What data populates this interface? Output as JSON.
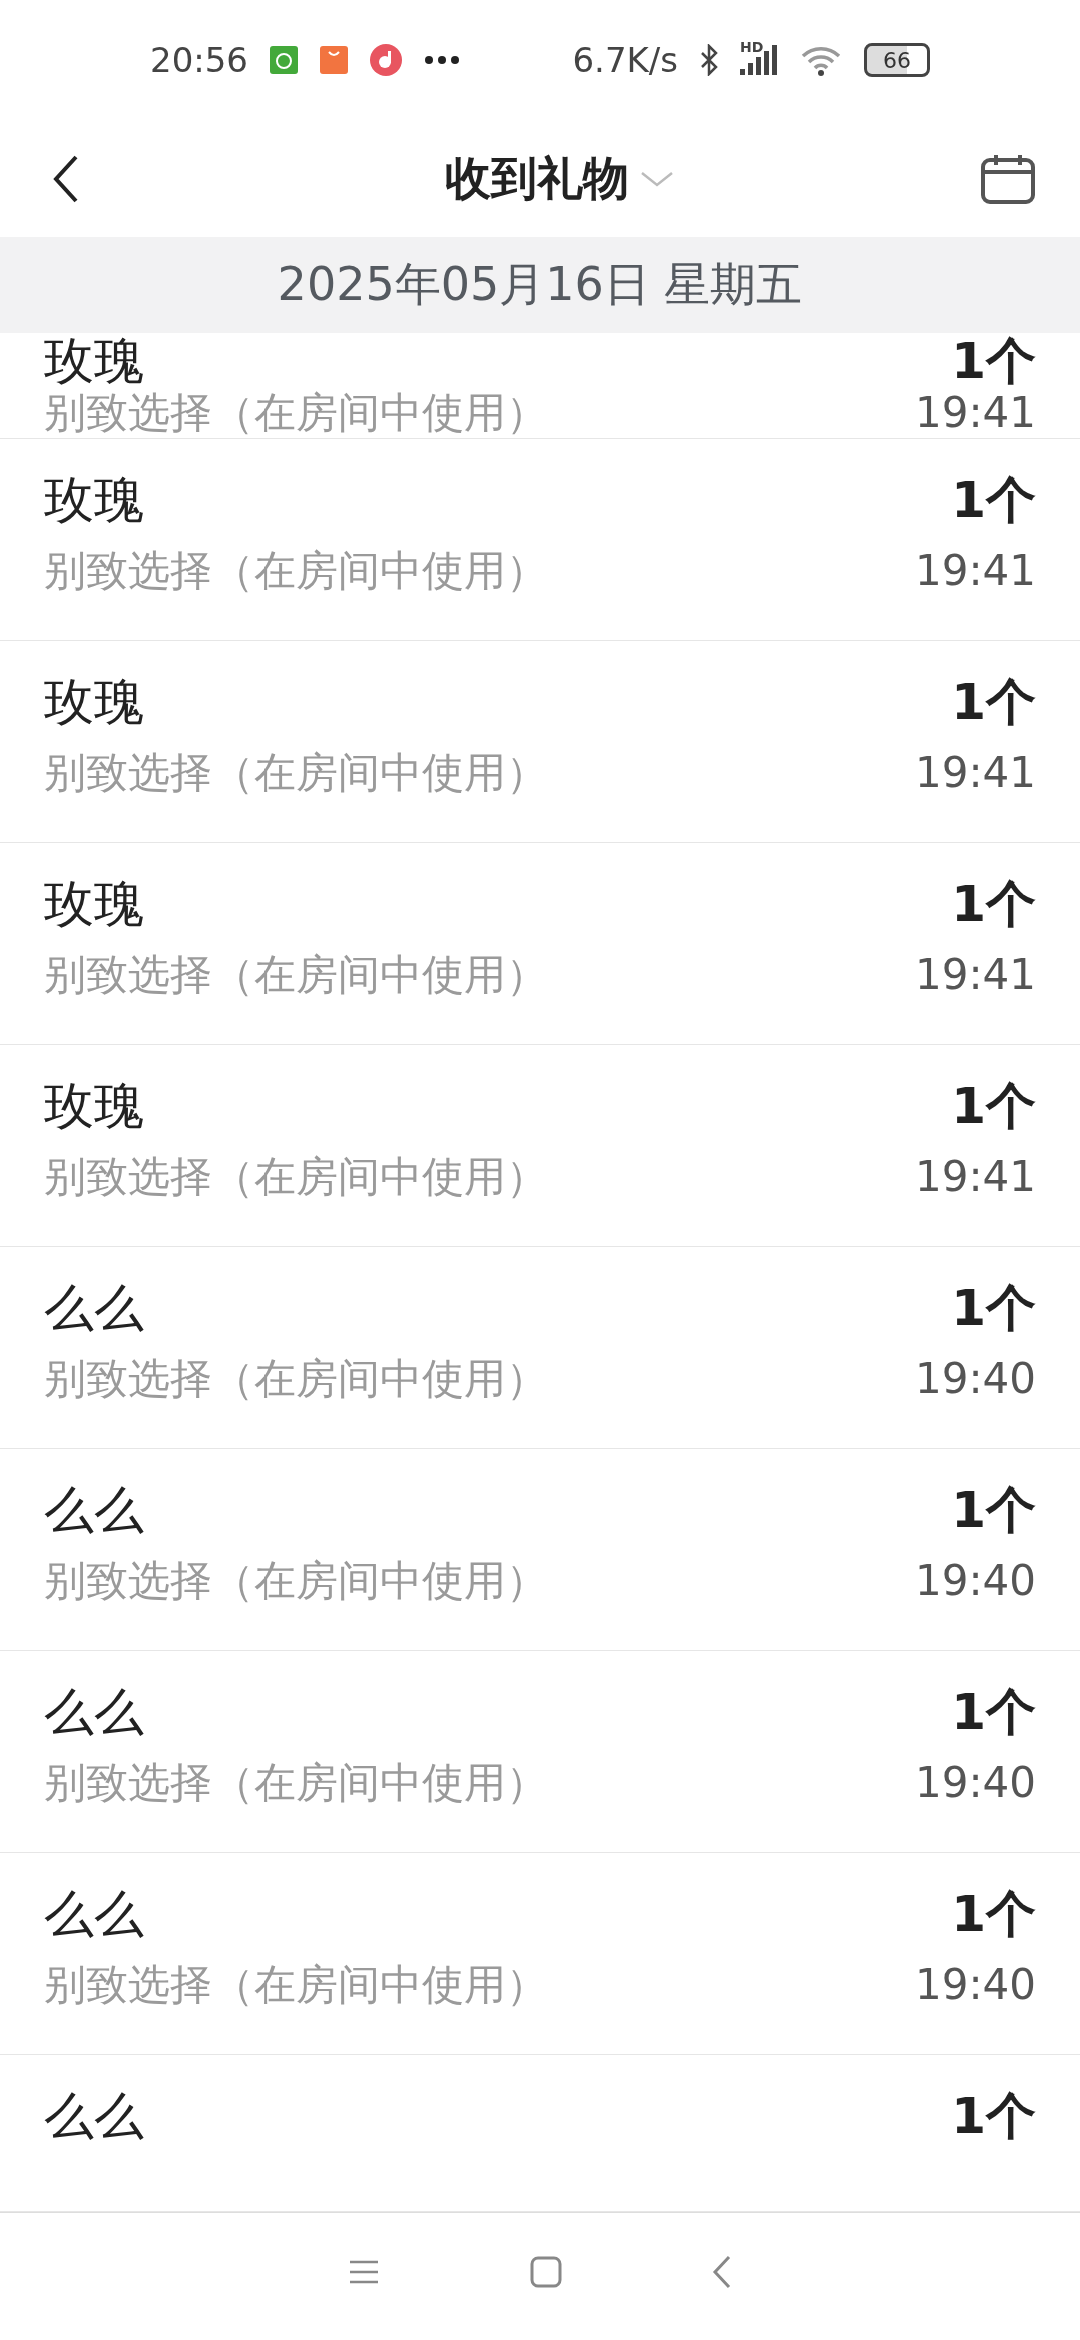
{
  "status_bar": {
    "time": "20:56",
    "net_speed": "6.7K/s",
    "signal_label": "HD",
    "battery": "66"
  },
  "header": {
    "title": "收到礼物"
  },
  "date_header": "2025年05月16日 星期五",
  "gifts": [
    {
      "name": "玫瑰",
      "source": "别致选择（在房间中使用）",
      "count": "1个",
      "time": "19:41"
    },
    {
      "name": "玫瑰",
      "source": "别致选择（在房间中使用）",
      "count": "1个",
      "time": "19:41"
    },
    {
      "name": "玫瑰",
      "source": "别致选择（在房间中使用）",
      "count": "1个",
      "time": "19:41"
    },
    {
      "name": "玫瑰",
      "source": "别致选择（在房间中使用）",
      "count": "1个",
      "time": "19:41"
    },
    {
      "name": "玫瑰",
      "source": "别致选择（在房间中使用）",
      "count": "1个",
      "time": "19:41"
    },
    {
      "name": "么么",
      "source": "别致选择（在房间中使用）",
      "count": "1个",
      "time": "19:40"
    },
    {
      "name": "么么",
      "source": "别致选择（在房间中使用）",
      "count": "1个",
      "time": "19:40"
    },
    {
      "name": "么么",
      "source": "别致选择（在房间中使用）",
      "count": "1个",
      "time": "19:40"
    },
    {
      "name": "么么",
      "source": "别致选择（在房间中使用）",
      "count": "1个",
      "time": "19:40"
    },
    {
      "name": "么么",
      "count": "1个"
    }
  ]
}
